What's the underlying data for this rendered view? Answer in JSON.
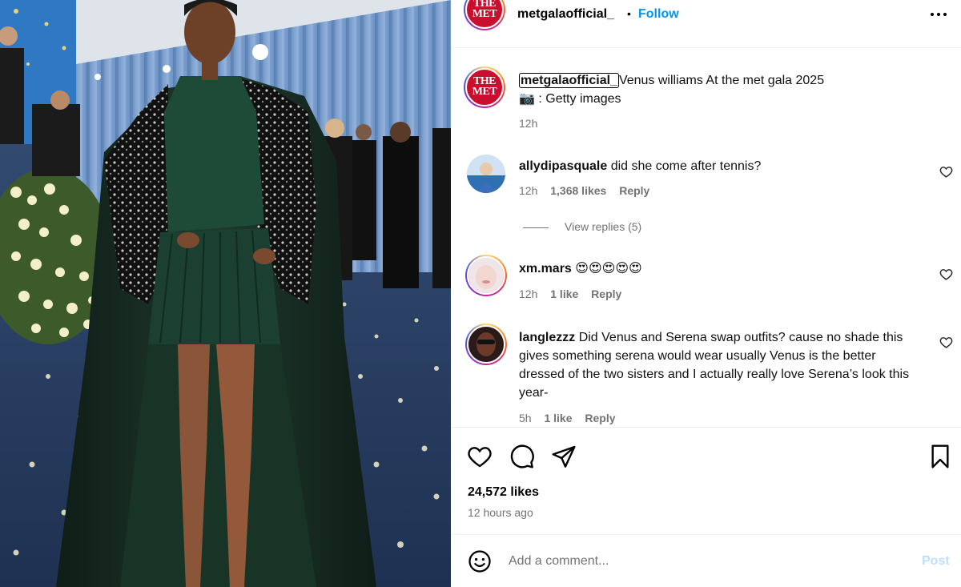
{
  "post": {
    "photo_alt": "Venus Williams at the Met Gala 2025",
    "logo_text_top": "THE",
    "logo_text_bottom": "MET"
  },
  "header": {
    "username": "metgalaofficial_",
    "dot": "•",
    "follow_label": "Follow",
    "more_label": "•••"
  },
  "caption": {
    "username": "metgalaofficial_",
    "text": "Venus williams At the met gala 2025",
    "credit": "📷 : Getty images",
    "time": "12h"
  },
  "comments": [
    {
      "username": "allydipasquale",
      "text": "did she come after tennis?",
      "time": "12h",
      "likes": "1,368 likes",
      "reply": "Reply",
      "view_replies": "View replies (5)"
    },
    {
      "username": "xm.mars",
      "text": "😍😍😍😍😍",
      "time": "12h",
      "likes": "1 like",
      "reply": "Reply"
    },
    {
      "username": "langlezzz",
      "text": "Did Venus and Serena swap outfits? cause no shade this gives something serena would wear usually Venus is the better dressed of the two sisters and I actually really love Serena’s look this year-",
      "time": "5h",
      "likes": "1 like",
      "reply": "Reply"
    }
  ],
  "engagement": {
    "likes": "24,572 likes",
    "time_ago": "12 hours ago"
  },
  "composer": {
    "placeholder": "Add a comment...",
    "post_label": "Post"
  },
  "colors": {
    "accent": "#0095f6",
    "met_red": "#c8102e",
    "muted": "#737373",
    "post_disabled": "#c0dffd"
  },
  "icons": [
    "more-icon",
    "heart-icon",
    "comment-icon",
    "share-icon",
    "bookmark-icon",
    "emoji-icon"
  ]
}
